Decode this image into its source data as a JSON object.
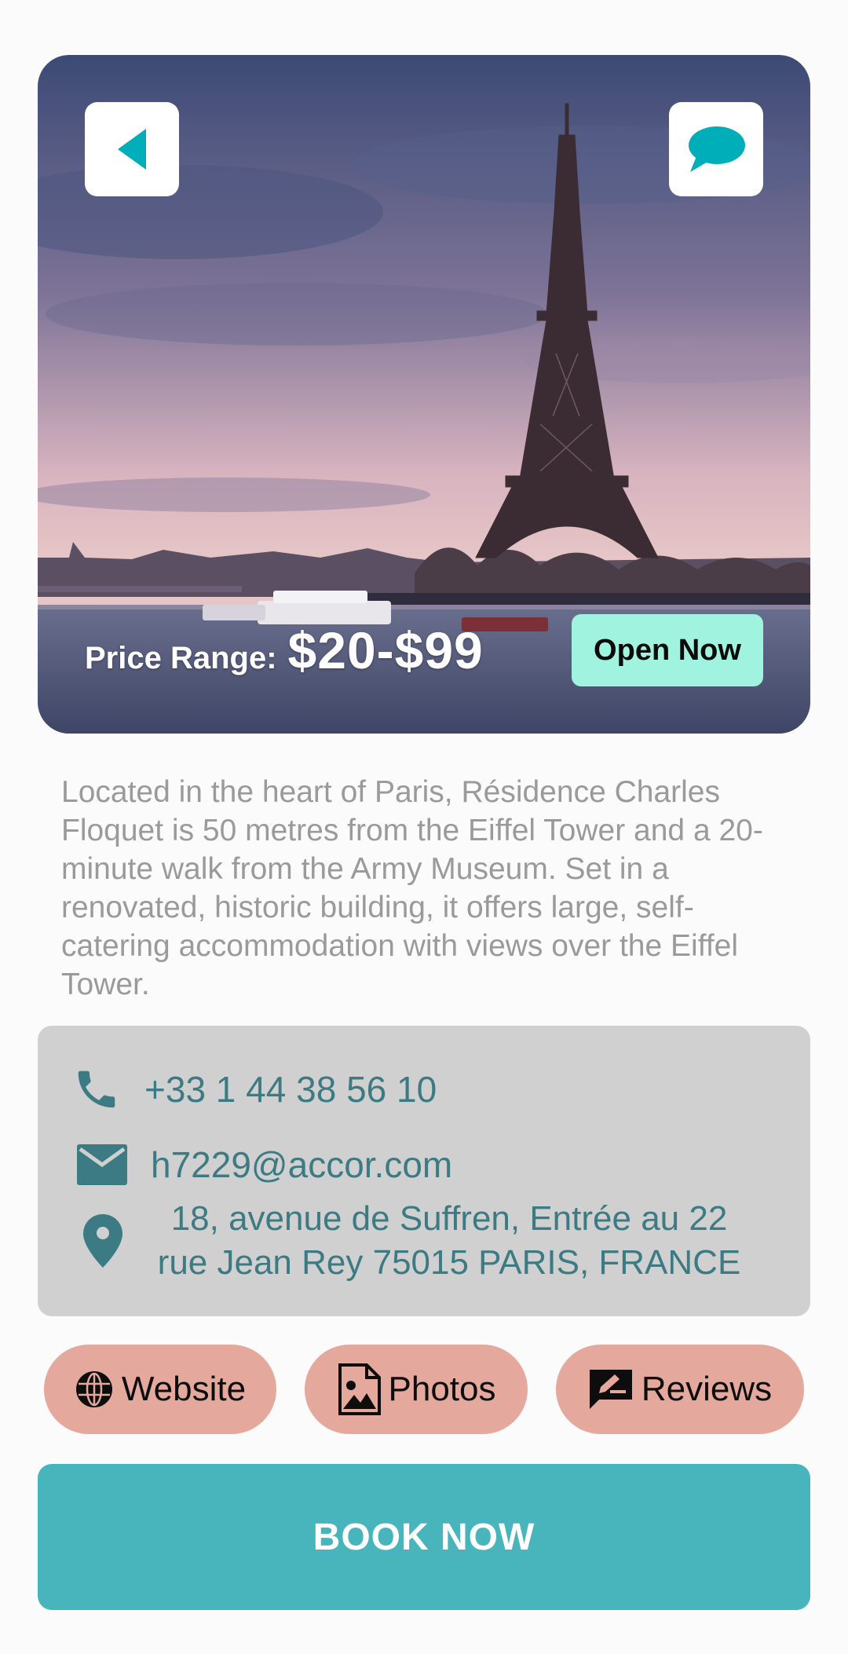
{
  "hero": {
    "image_alt": "Eiffel Tower and the Seine at dusk",
    "back_icon": "back-arrow-icon",
    "chat_icon": "chat-bubble-icon",
    "price_label": "Price Range:",
    "price_value": "$20-$99",
    "status_badge": "Open Now"
  },
  "description": "Located in the heart of Paris, Résidence Charles Floquet is 50 metres from the Eiffel Tower and a 20-minute walk from the Army Museum. Set in a renovated, historic building, it offers large, self-catering accommodation with views over the Eiffel Tower.",
  "contact": {
    "phone": "+33 1 44 38 56 10",
    "email": "h7229@accor.com",
    "address": "18, avenue de Suffren, Entrée au 22 rue Jean Rey 75015 PARIS, FRANCE"
  },
  "actions": {
    "website": "Website",
    "photos": "Photos",
    "reviews": "Reviews"
  },
  "book_label": "BOOK NOW",
  "colors": {
    "accent_teal": "#48b5bd",
    "icon_teal": "#00aeb9",
    "contact_text": "#3c7b83",
    "pill_bg": "#e5a89c",
    "badge_bg": "#9ff3df",
    "card_bg": "#d0d0d0"
  }
}
